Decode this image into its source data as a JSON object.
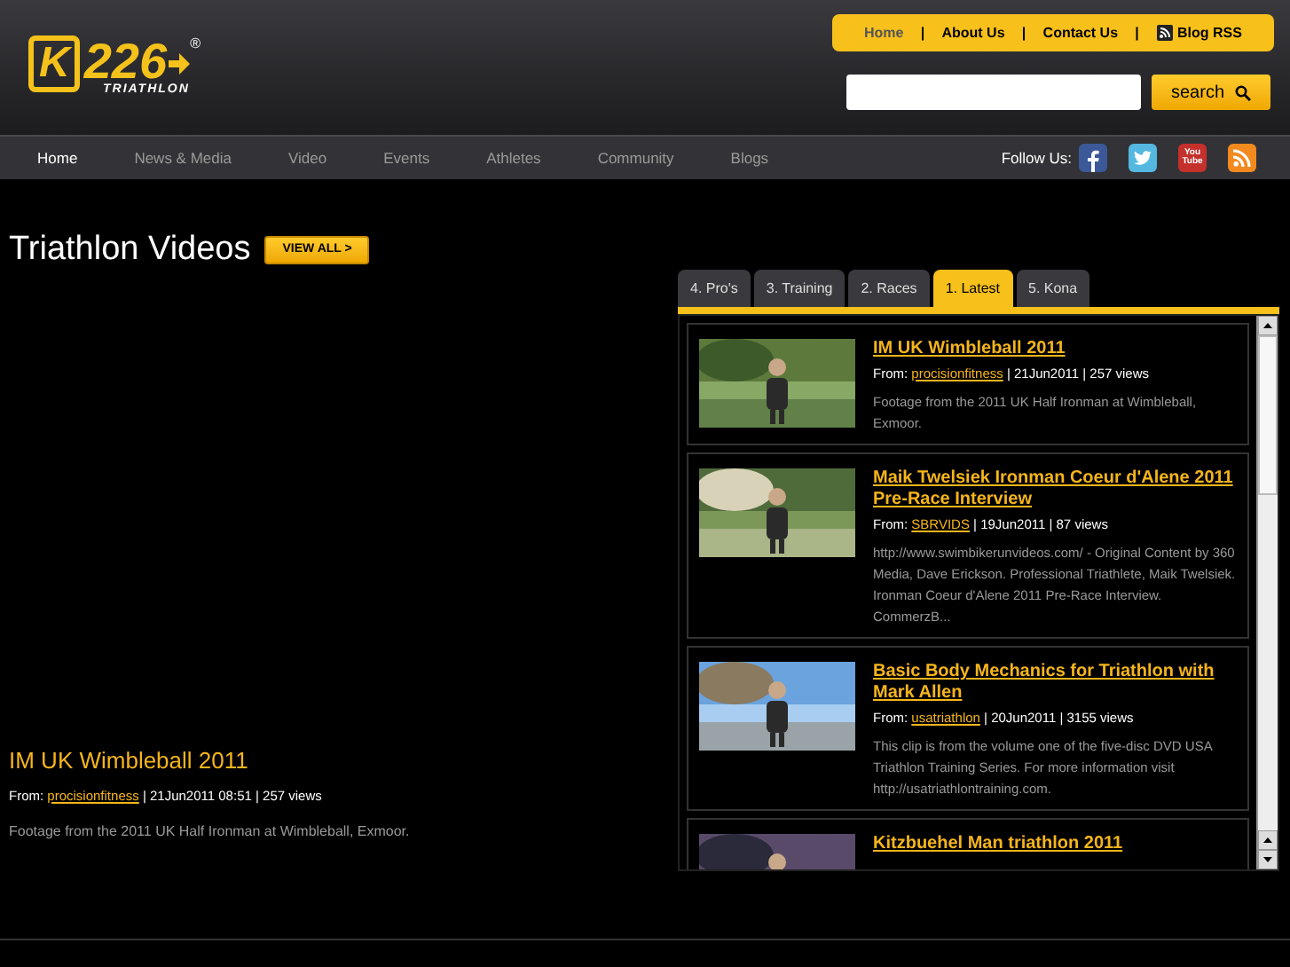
{
  "logo": {
    "mark": "K",
    "number": "226",
    "registered": "®",
    "tagline": "TRIATHLON"
  },
  "top_links": {
    "separator": "|",
    "items": [
      {
        "label": "Home",
        "selected": true,
        "kind": "text"
      },
      {
        "label": "About Us",
        "selected": false,
        "kind": "text"
      },
      {
        "label": "Contact Us",
        "selected": false,
        "kind": "text"
      },
      {
        "label": "Blog RSS",
        "selected": false,
        "kind": "rss"
      }
    ]
  },
  "search": {
    "button": "search"
  },
  "nav": {
    "items": [
      {
        "label": "Home",
        "selected": true
      },
      {
        "label": "News & Media",
        "selected": false
      },
      {
        "label": "Video",
        "selected": false
      },
      {
        "label": "Events",
        "selected": false
      },
      {
        "label": "Athletes",
        "selected": false
      },
      {
        "label": "Community",
        "selected": false
      },
      {
        "label": "Blogs",
        "selected": false
      }
    ],
    "follow_label": "Follow Us:",
    "social": [
      {
        "kind": "facebook"
      },
      {
        "kind": "twitter"
      },
      {
        "kind": "youtube",
        "text": "You Tube"
      },
      {
        "kind": "rss"
      }
    ]
  },
  "section": {
    "title": "Triathlon Videos",
    "view_all": "VIEW ALL >"
  },
  "featured": {
    "title": "IM UK Wimbleball 2011",
    "from_label": "From:",
    "author": "procisionfitness",
    "meta": "| 21Jun2011 08:51 | 257 views",
    "description": "Footage from the 2011 UK Half Ironman at Wimbleball, Exmoor."
  },
  "tabs": [
    {
      "label": "4. Pro's",
      "selected": false
    },
    {
      "label": "3. Training",
      "selected": false
    },
    {
      "label": "2. Races",
      "selected": false
    },
    {
      "label": "1. Latest",
      "selected": true
    },
    {
      "label": "5. Kona",
      "selected": false
    }
  ],
  "videos": [
    {
      "title": "IM UK Wimbleball 2011",
      "from_label": "From:",
      "author": "procisionfitness",
      "meta": "| 21Jun2011 | 257 views",
      "description": "Footage from the 2011 UK Half Ironman at Wimbleball, Exmoor."
    },
    {
      "title": "Maik Twelsiek Ironman Coeur d'Alene 2011 Pre-Race Interview",
      "from_label": "From:",
      "author": "SBRVIDS",
      "meta": "| 19Jun2011 | 87 views",
      "description": "http://www.swimbikerunvideos.com/ - Original Content by 360 Media, Dave Erickson. Professional Triathlete, Maik Twelsiek. Ironman Coeur d'Alene 2011 Pre-Race Interview. CommerzB..."
    },
    {
      "title": "Basic Body Mechanics for Triathlon with Mark Allen",
      "from_label": "From:",
      "author": "usatriathlon",
      "meta": "| 20Jun2011 | 3155 views",
      "description": "This clip is from the volume one of the five-disc DVD USA Triathlon Training Series. For more information visit http://usatriathlontraining.com."
    },
    {
      "title": "Kitzbuehel Man triathlon 2011"
    }
  ]
}
